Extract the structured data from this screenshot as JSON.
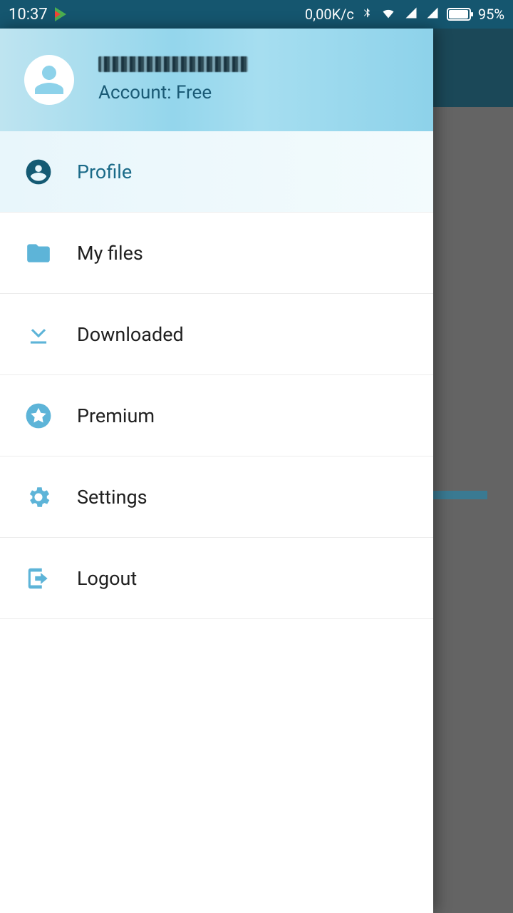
{
  "status": {
    "time": "10:37",
    "data_rate": "0,00K/c",
    "battery_pct": "95%"
  },
  "header": {
    "account_line": "Account: Free"
  },
  "menu": {
    "profile": "Profile",
    "my_files": "My files",
    "downloaded": "Downloaded",
    "premium": "Premium",
    "settings": "Settings",
    "logout": "Logout"
  }
}
